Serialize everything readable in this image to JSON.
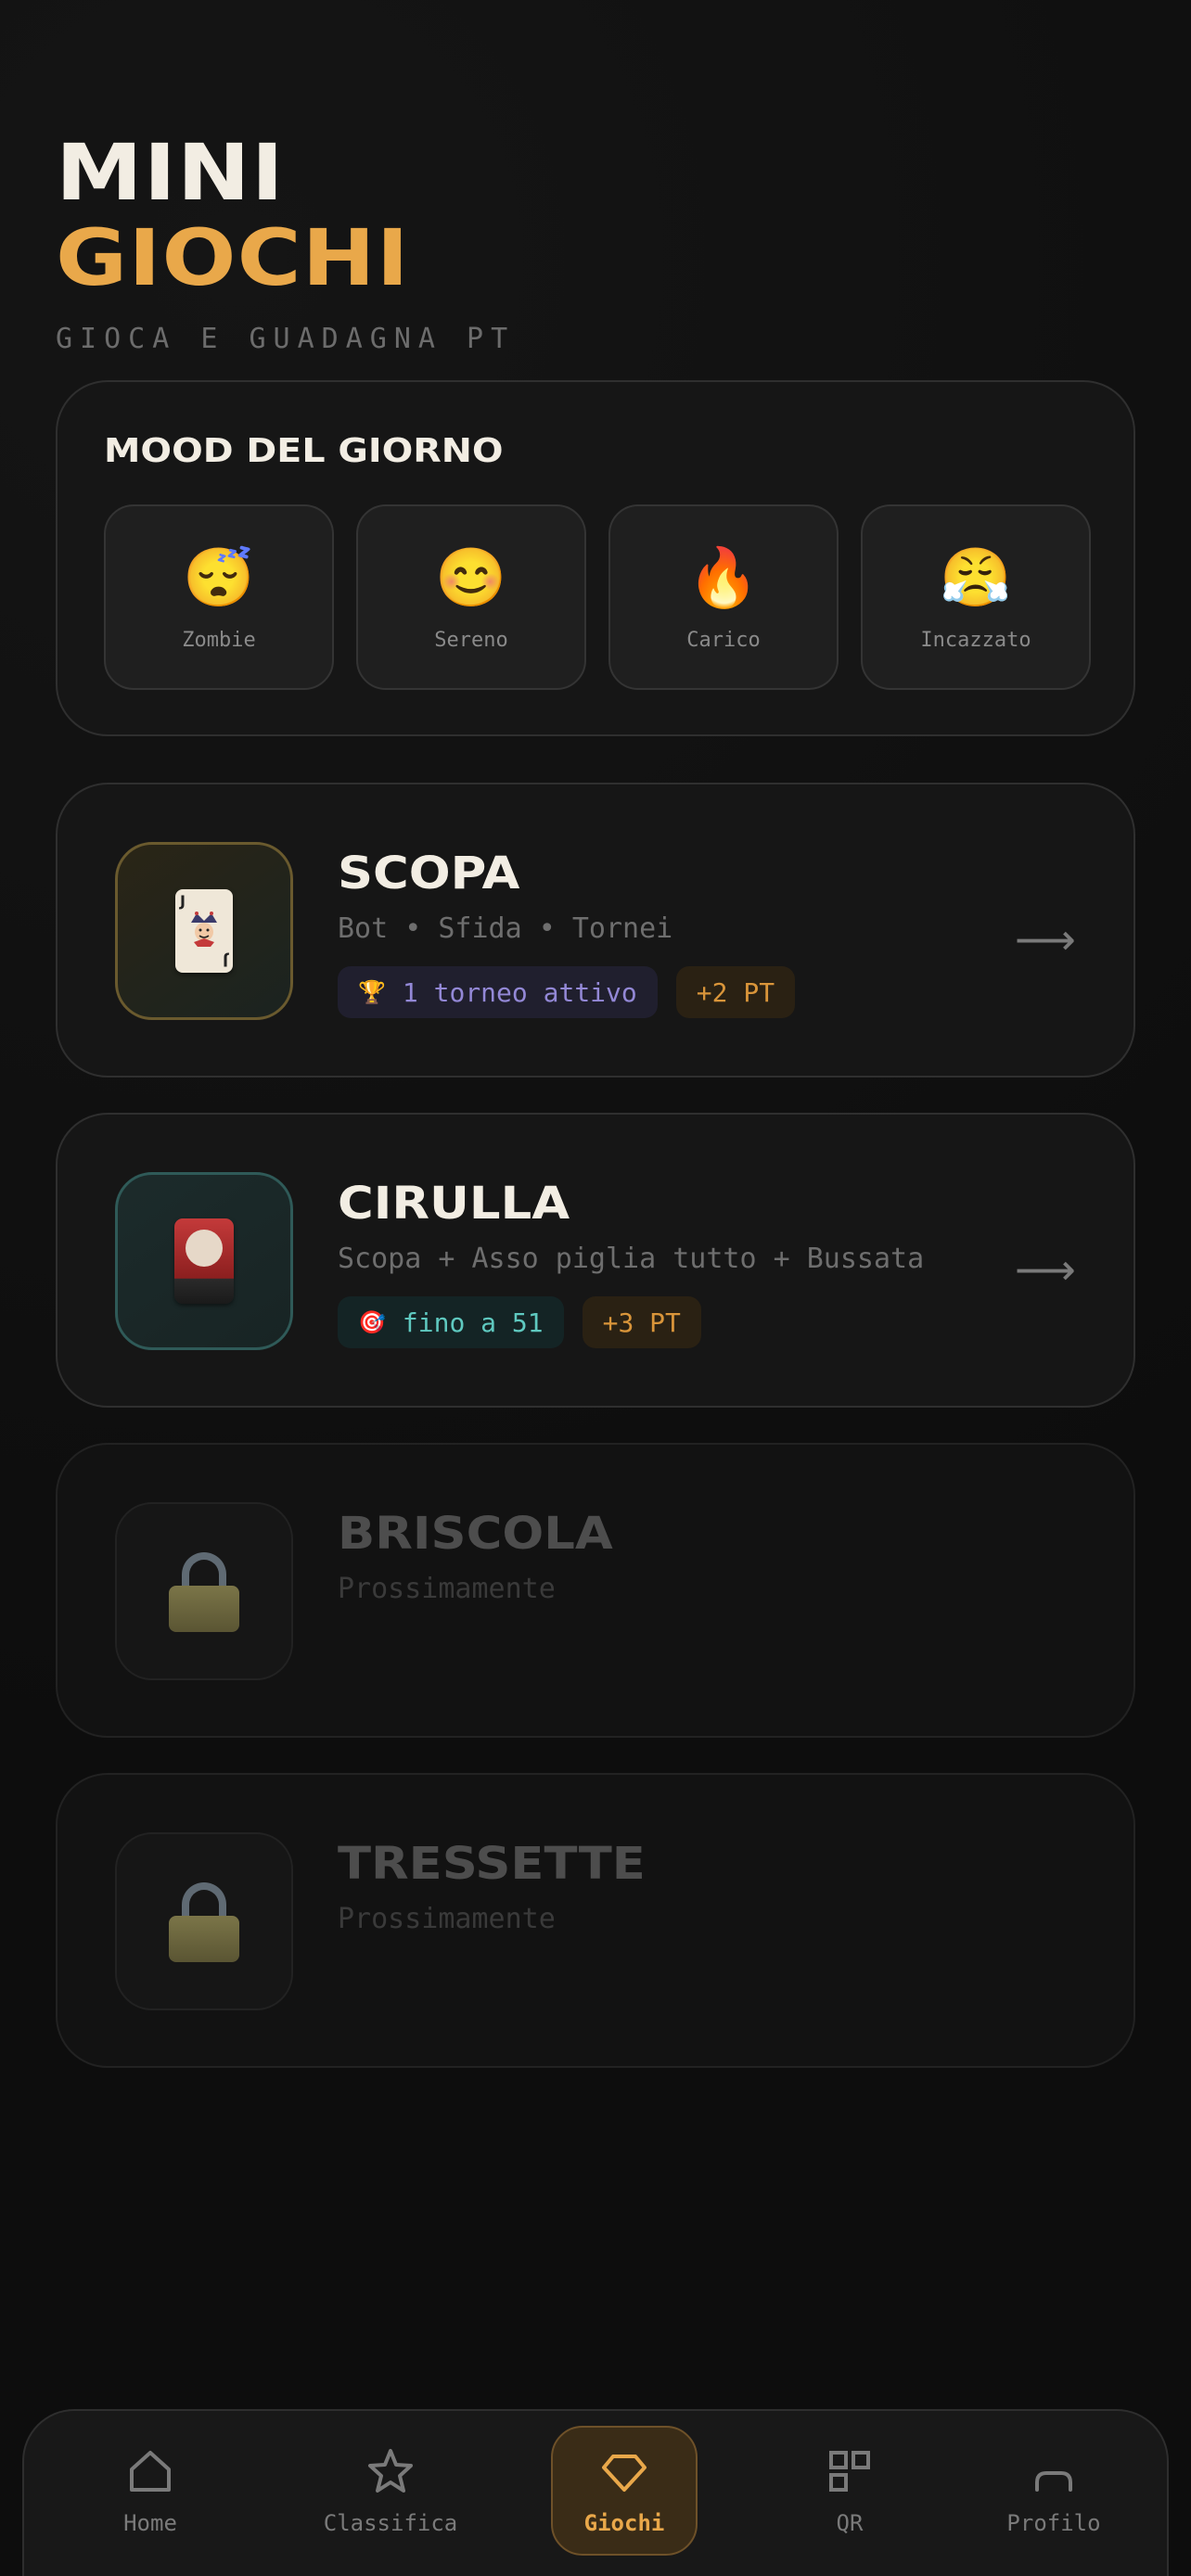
{
  "header": {
    "title_line1": "MINI",
    "title_line2": "GIOCHI",
    "subtitle": "GIOCA E GUADAGNA PT"
  },
  "mood": {
    "title": "MOOD DEL GIORNO",
    "options": [
      {
        "emoji": "😴",
        "label": "Zombie"
      },
      {
        "emoji": "😊",
        "label": "Sereno"
      },
      {
        "emoji": "🔥",
        "label": "Carico"
      },
      {
        "emoji": "😤",
        "label": "Incazzato"
      }
    ]
  },
  "games": [
    {
      "name": "SCOPA",
      "description": "Bot • Sfida • Tornei",
      "icon": "joker-card-icon",
      "card_corner": "J",
      "badges": [
        {
          "icon": "🏆",
          "text": "1 torneo attivo"
        },
        {
          "text": "+2 PT"
        }
      ]
    },
    {
      "name": "CIRULLA",
      "description": "Scopa + Asso piglia tutto + Bussata",
      "icon": "red-card-icon",
      "badges": [
        {
          "icon": "🎯",
          "text": "fino a 51"
        },
        {
          "text": "+3 PT"
        }
      ]
    },
    {
      "name": "BRISCOLA",
      "description": "Prossimamente",
      "icon": "lock-icon"
    },
    {
      "name": "TRESSETTE",
      "description": "Prossimamente",
      "icon": "lock-icon"
    }
  ],
  "nav": {
    "items": [
      {
        "label": "Home",
        "icon": "home-icon"
      },
      {
        "label": "Classifica",
        "icon": "star-icon"
      },
      {
        "label": "Giochi",
        "icon": "diamond-icon",
        "active": true
      },
      {
        "label": "QR",
        "icon": "qr-icon"
      },
      {
        "label": "Profilo",
        "icon": "profile-icon"
      }
    ]
  },
  "colors": {
    "accent": "#e9a84a",
    "background": "#0d0d0d",
    "card": "#161616",
    "tourney_badge": "#9388d6",
    "target_badge": "#5fc9c0"
  }
}
